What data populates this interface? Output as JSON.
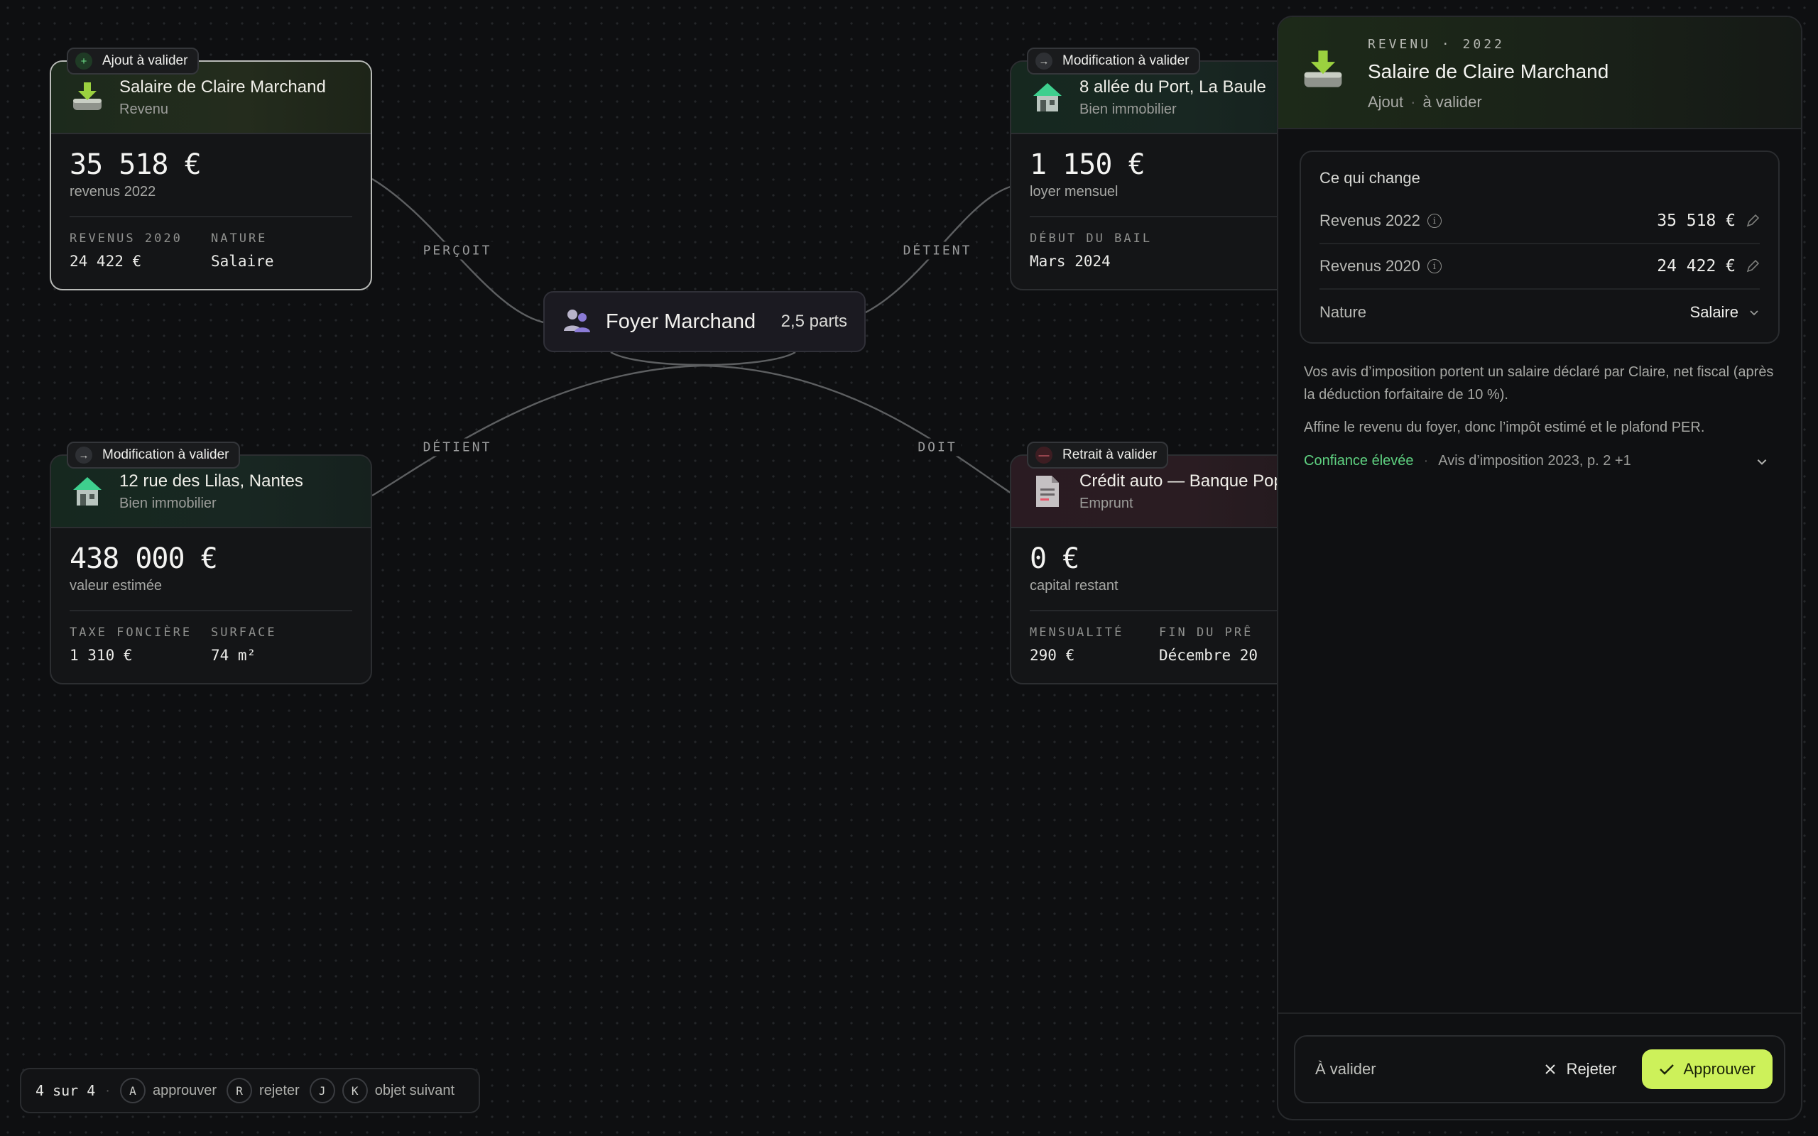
{
  "edges": {
    "percoit": "PERÇOIT",
    "detient_top": "DÉTIENT",
    "detient_left": "DÉTIENT",
    "doit": "DOIT"
  },
  "household": {
    "name": "Foyer Marchand",
    "parts": "2,5 parts"
  },
  "cards": {
    "salaire": {
      "badge": "Ajout à valider",
      "title": "Salaire de Claire Marchand",
      "subtitle": "Revenu",
      "amount": "35 518 €",
      "amount_label": "revenus 2022",
      "facts": [
        {
          "key": "REVENUS 2020",
          "value": "24 422 €"
        },
        {
          "key": "NATURE",
          "value": "Salaire"
        }
      ]
    },
    "port": {
      "badge": "Modification à valider",
      "title": "8 allée du Port, La Baule",
      "subtitle": "Bien immobilier",
      "amount": "1 150 €",
      "amount_label": "loyer mensuel",
      "facts": [
        {
          "key": "DÉBUT DU BAIL",
          "value": "Mars 2024"
        }
      ]
    },
    "lilas": {
      "badge": "Modification à valider",
      "title": "12 rue des Lilas, Nantes",
      "subtitle": "Bien immobilier",
      "amount": "438 000 €",
      "amount_label": "valeur estimée",
      "facts": [
        {
          "key": "TAXE FONCIÈRE",
          "value": "1 310 €"
        },
        {
          "key": "SURFACE",
          "value": "74 m²"
        }
      ]
    },
    "credit": {
      "badge": "Retrait à valider",
      "title": "Crédit auto — Banque Pop",
      "subtitle": "Emprunt",
      "amount": "0 €",
      "amount_label": "capital restant",
      "facts": [
        {
          "key": "MENSUALITÉ",
          "value": "290 €"
        },
        {
          "key": "FIN DU PRÊ",
          "value": "Décembre 20"
        }
      ]
    }
  },
  "panel": {
    "eyebrow": "REVENU · 2022",
    "title": "Salaire de Claire Marchand",
    "subtitle_kind": "Ajout",
    "subtitle_status": "à valider",
    "changes_title": "Ce qui change",
    "rows": [
      {
        "label": "Revenus 2022",
        "value": "35 518 €"
      },
      {
        "label": "Revenus 2020",
        "value": "24 422 €"
      },
      {
        "label": "Nature",
        "value": "Salaire"
      }
    ],
    "note_1": "Vos avis d’imposition portent un salaire déclaré par Claire, net fiscal (après la déduction forfaitaire de 10 %).",
    "note_2": "Affine le revenu du foyer, donc l’impôt estimé et le plafond PER.",
    "confidence": "Confiance élevée",
    "source": "Avis d’imposition 2023, p. 2 +1",
    "status": "À valider",
    "reject_label": "Rejeter",
    "approve_label": "Approuver",
    "accent": "#cdf15a"
  },
  "keybar": {
    "count": "4 sur 4",
    "keys": [
      {
        "key": "A",
        "label": "approuver"
      },
      {
        "key": "R",
        "label": "rejeter"
      },
      {
        "key": "J",
        "label": ""
      },
      {
        "key": "K",
        "label": "objet suivant"
      }
    ]
  }
}
